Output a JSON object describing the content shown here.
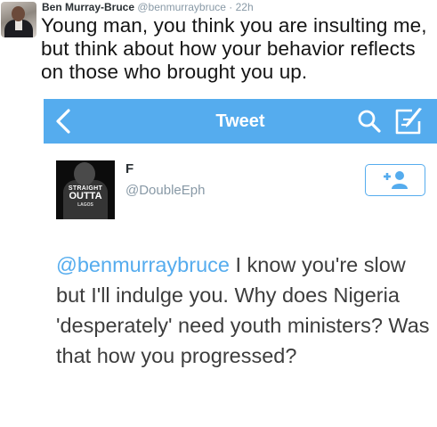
{
  "outer_tweet": {
    "author_name": "Ben Murray-Bruce",
    "author_handle": "@benmurraybruce",
    "separator": "·",
    "time": "22h",
    "text": "Young man, you think you are insulting me, but think about how your behavior reflects on those who brought you up."
  },
  "embedded": {
    "nav": {
      "title": "Tweet",
      "back_icon": "chevron-left-icon",
      "search_icon": "search-icon",
      "compose_icon": "compose-icon",
      "bar_color": "#55acee"
    },
    "tweet": {
      "author_name": "F",
      "author_handle": "@DoubleEph",
      "avatar_text": [
        "STRAIGHT",
        "OUTTA",
        "LAGOS"
      ],
      "follow_icon": "add-user-icon",
      "mention": "@benmurraybruce",
      "text": " I know you're slow but I'll indulge you. Why does Nigeria 'desperately' need youth ministers? Was that how you progressed?",
      "mention_color": "#55acee"
    }
  }
}
